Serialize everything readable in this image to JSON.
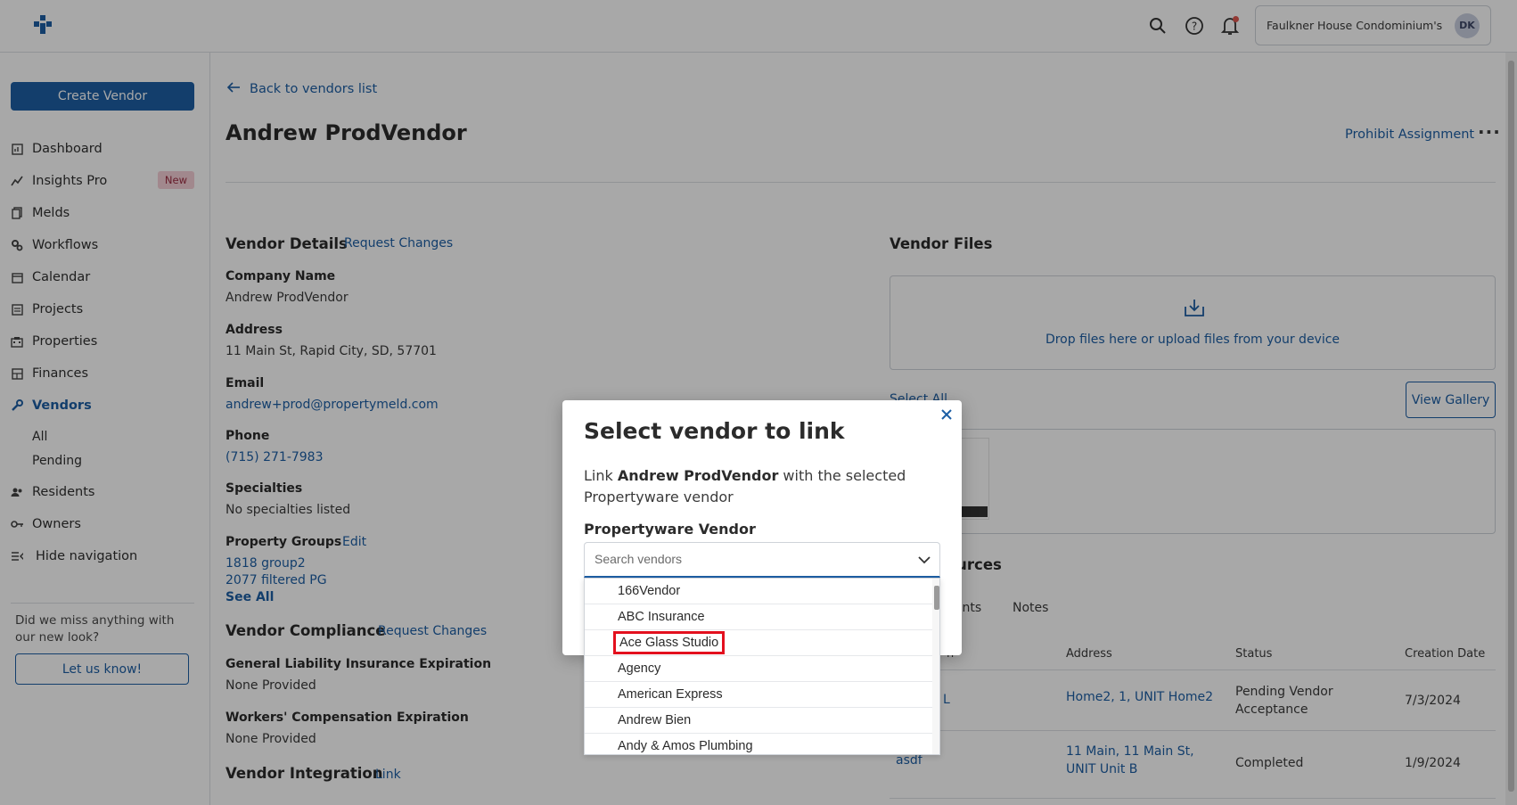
{
  "header": {
    "account_name": "Faulkner House Condominium's",
    "avatar_initials": "DK"
  },
  "sidebar": {
    "create_label": "Create Vendor",
    "items": [
      {
        "label": "Dashboard",
        "icon": "dashboard-icon"
      },
      {
        "label": "Insights Pro",
        "icon": "chart-icon",
        "badge": "New"
      },
      {
        "label": "Melds",
        "icon": "copy-icon"
      },
      {
        "label": "Workflows",
        "icon": "gears-icon"
      },
      {
        "label": "Calendar",
        "icon": "calendar-icon"
      },
      {
        "label": "Projects",
        "icon": "list-icon"
      },
      {
        "label": "Properties",
        "icon": "building-icon"
      },
      {
        "label": "Finances",
        "icon": "ledger-icon"
      },
      {
        "label": "Vendors",
        "icon": "wrench-icon",
        "active": true
      }
    ],
    "vendor_sub": [
      "All",
      "Pending"
    ],
    "items_after": [
      {
        "label": "Residents",
        "icon": "people-icon"
      },
      {
        "label": "Owners",
        "icon": "key-icon"
      },
      {
        "label": "Hide navigation",
        "icon": "collapse-icon"
      }
    ],
    "miss_text": "Did we miss anything with our new look?",
    "letus_label": "Let us know!"
  },
  "page": {
    "back_label": "Back to vendors list",
    "title": "Andrew ProdVendor",
    "prohibit_label": "Prohibit Assignment",
    "more_label": "···"
  },
  "details": {
    "heading": "Vendor Details",
    "request_changes": "Request Changes",
    "company_label": "Company Name",
    "company_value": "Andrew ProdVendor",
    "address_label": "Address",
    "address_value": "11 Main St, Rapid City, SD, 57701",
    "email_label": "Email",
    "email_value": "andrew+prod@propertymeld.com",
    "phone_label": "Phone",
    "phone_value": "(715) 271-7983",
    "specialties_label": "Specialties",
    "specialties_value": "No specialties listed",
    "groups_label": "Property Groups",
    "groups_edit": "Edit",
    "groups": [
      "1818 group2",
      "2077 filtered PG"
    ],
    "see_all": "See All"
  },
  "compliance": {
    "heading": "Vendor Compliance",
    "request_changes": "Request Changes",
    "gl_label": "General Liability Insurance Expiration",
    "gl_value": "None Provided",
    "wc_label": "Workers' Compensation Expiration",
    "wc_value": "None Provided"
  },
  "integration": {
    "heading": "Vendor Integration",
    "link": "Link"
  },
  "files": {
    "heading": "Vendor Files",
    "drop_text": "Drop files here or upload files from your device",
    "select_all": "Select All",
    "view_gallery": "View Gallery"
  },
  "resources": {
    "heading_fragment": "sources",
    "tabs": [
      "gents",
      "Notes"
    ],
    "columns": [
      "n",
      "Address",
      "Status",
      "Creation Date"
    ],
    "rows": [
      {
        "name": "L",
        "address": "Home2, 1, UNIT Home2",
        "status": "Pending Vendor Acceptance",
        "date": "7/3/2024"
      },
      {
        "name": "asdf",
        "address": "11 Main, 11 Main St, UNIT Unit B",
        "status": "Completed",
        "date": "1/9/2024"
      }
    ]
  },
  "modal": {
    "title": "Select vendor to link",
    "desc_prefix": "Link",
    "desc_vendor": "Andrew ProdVendor",
    "desc_suffix": "with the selected Propertyware vendor",
    "field_label": "Propertyware Vendor",
    "search_placeholder": "Search vendors",
    "options": [
      "166Vendor",
      "ABC Insurance",
      "Ace Glass Studio",
      "Agency",
      "American Express",
      "Andrew Bien",
      "Andy & Amos Plumbing"
    ],
    "highlighted_option": "Ace Glass Studio"
  }
}
